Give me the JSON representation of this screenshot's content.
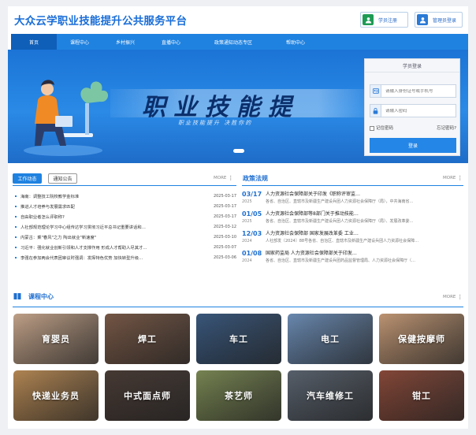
{
  "header": {
    "site_title": "大众云学职业技能提升公共服务平台",
    "register_label": "学员注册",
    "admin_label": "管理员登录"
  },
  "nav": {
    "items": [
      "首页",
      "课程中心",
      "乡村振兴",
      "直播中心",
      "政策通知动态专区",
      "帮助中心"
    ],
    "active": "首页"
  },
  "banner": {
    "headline": "职业技能提",
    "subline": "职业技能提升  决胜你的"
  },
  "login": {
    "title": "学员登录",
    "id_placeholder": "请输入身份证号或手机号",
    "pw_placeholder": "请输入密码",
    "remember_label": "记住密码",
    "forgot_label": "忘记密码?",
    "submit_label": "登录"
  },
  "work": {
    "tab_active": "工作动态",
    "tab_other": "通知公告",
    "more_label": "MORE",
    "items": [
      {
        "title": "海南：调整技工院校教学金标准",
        "date": "2025-03-17"
      },
      {
        "title": "推进人才培养与发展需求匹配",
        "date": "2025-03-17"
      },
      {
        "title": "自由职业者怎么评职称?",
        "date": "2025-03-17"
      },
      {
        "title": "人社部规范理论学习中心组传达学习贯彻习近平总书记重要讲话和…",
        "date": "2025-03-12"
      },
      {
        "title": "内蒙古：乘\"春风\"之力 陶出就业\"新速度\"",
        "date": "2025-03-10"
      },
      {
        "title": "习近平：强化就业创新引领和人才支撑作用 形成人才帮助人尽其才…",
        "date": "2025-03-07"
      },
      {
        "title": "李强在参加两会代表团审议时强调：发挥特色优势 加快转型升级…",
        "date": "2025-03-06"
      }
    ]
  },
  "policy": {
    "title": "政策法规",
    "more_label": "MORE",
    "items": [
      {
        "md": "03/17",
        "year": "2025",
        "title": "人力资源社会保障部关于印发《职称评审监…",
        "desc": "各省、自治区、直辖市及新疆生产建设兵团人力资源社会保障厅（局），中共海南省…"
      },
      {
        "md": "01/05",
        "year": "2025",
        "title": "人力资源社会保障部等8部门关于推动技能…",
        "desc": "各省、自治区、直辖市及新疆生产建设兵团人力资源社会保障厅（局）、发展改革委…"
      },
      {
        "md": "12/03",
        "year": "2024",
        "title": "人力资源社会保障部 国家发展改革委 工业…",
        "desc": "人社部发〔2024〕88号各省、自治区、直辖市及新疆生产建设兵团人力资源社会保障…"
      },
      {
        "md": "01/08",
        "year": "2024",
        "title": "国家药监局 人力资源社会保障部关于印发…",
        "desc": "各省、自治区、直辖市及新疆生产建设兵团药品监督管理局、人力资源社会保障厅（…"
      }
    ]
  },
  "courses": {
    "title": "课程中心",
    "more_label": "MORE",
    "items": [
      {
        "label": "育婴员",
        "color": "#c9a88e"
      },
      {
        "label": "焊工",
        "color": "#7a5a48"
      },
      {
        "label": "车工",
        "color": "#3b5a80"
      },
      {
        "label": "电工",
        "color": "#6e8fb8"
      },
      {
        "label": "保健按摩师",
        "color": "#c69b78"
      },
      {
        "label": "快递业务员",
        "color": "#b98b56"
      },
      {
        "label": "中式面点师",
        "color": "#4a3c36"
      },
      {
        "label": "茶艺师",
        "color": "#7c8a55"
      },
      {
        "label": "汽车维修工",
        "color": "#5b6470"
      },
      {
        "label": "钳工",
        "color": "#8a4a3a"
      }
    ]
  }
}
